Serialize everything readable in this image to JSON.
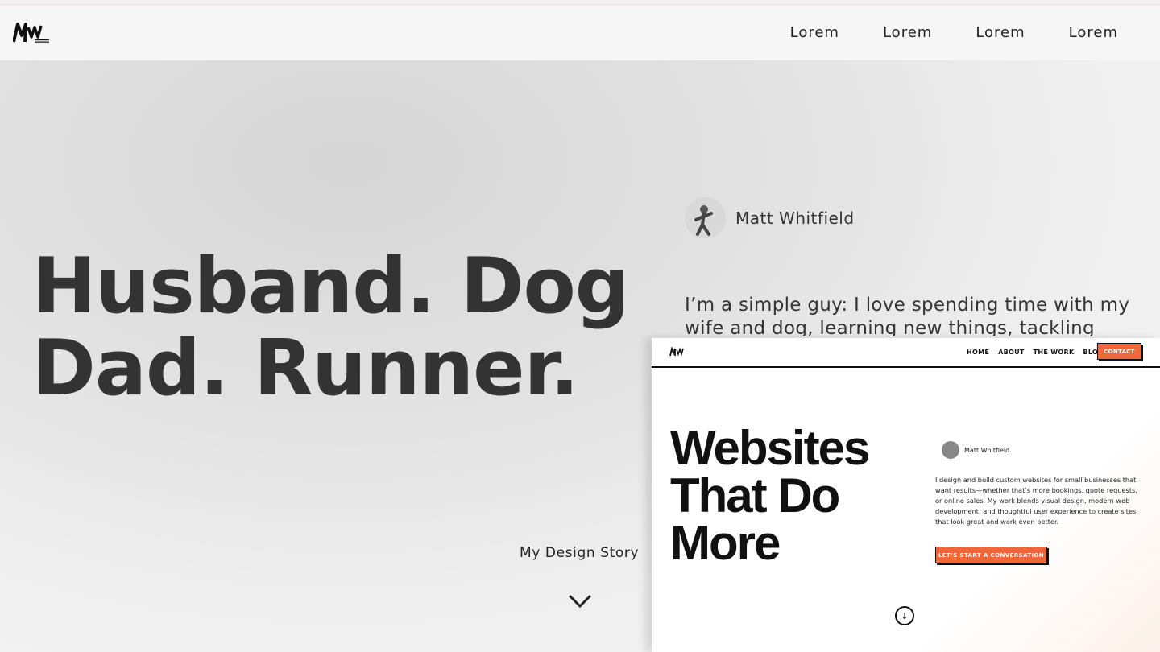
{
  "header": {
    "logo_icon": "mw-logo-icon",
    "nav": [
      "Lorem",
      "Lorem",
      "Lorem",
      "Lorem"
    ]
  },
  "hero": {
    "headline_line1": "Husband. Dog",
    "headline_line2": "Dad. Runner.",
    "profile_name": "Matt Whitfield",
    "bio": "I’m a simple guy: I love spending time with my wife and dog, learning new things, tackling",
    "story_label": "My Design Story",
    "story_icon": "chevron-down-icon"
  },
  "preview": {
    "nav": [
      "HOME",
      "ABOUT",
      "THE WORK",
      "BLOG"
    ],
    "contact": "CONTACT",
    "headline": [
      "Websites",
      "That Do",
      "More"
    ],
    "profile_name": "Matt Whitfield",
    "bio": "I design and build custom websites for small businesses that want results—whether that’s more bookings, quote requests, or online sales. My work blends visual design, modern web development, and thoughtful user experience to create sites that look great and work even better.",
    "cta": "LET’S START A CONVERSATION",
    "scroll_icon": "arrow-down-circle-icon",
    "accent_color": "#f2673a"
  }
}
